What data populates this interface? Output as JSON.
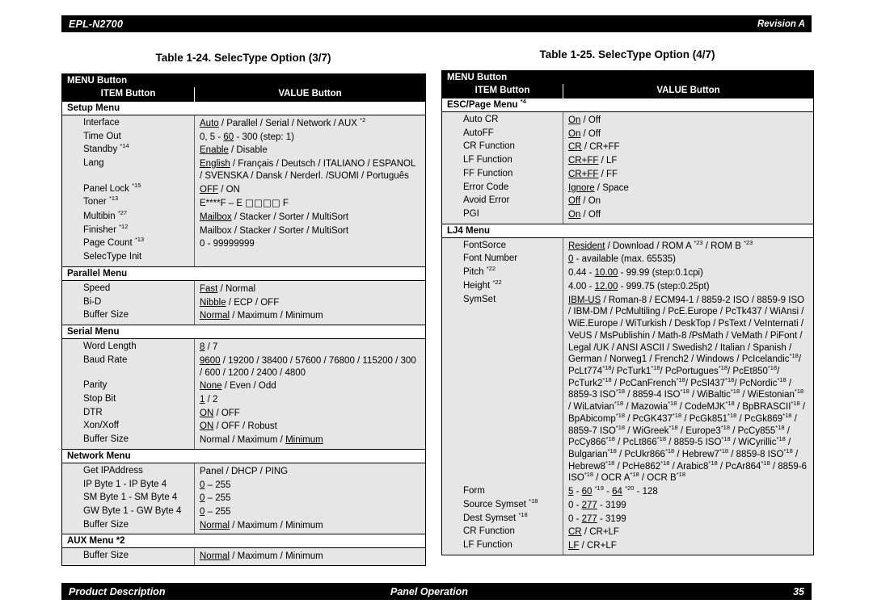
{
  "header": {
    "model": "EPL-N2700",
    "revision": "Revision A"
  },
  "footer": {
    "left": "Product Description",
    "center": "Panel Operation",
    "page": "35"
  },
  "tables": [
    {
      "caption": "Table 1-24.  SelecType Option (3/7)",
      "menu_header": "MENU Button",
      "col_item": "ITEM Button",
      "col_value": "VALUE Button",
      "sections": [
        {
          "title": "Setup Menu",
          "rows": [
            {
              "item": "Interface",
              "value": "<u>Auto</u> / Parallel / Serial / Network / AUX <sup>*2</sup>"
            },
            {
              "item": "Time Out",
              "value": "0, 5 - <u>60</u> - 300 (step: 1)"
            },
            {
              "item": "Standby <sup>*14</sup>",
              "value": "<u>Enable</u> / Disable"
            },
            {
              "item": "Lang",
              "value": "<u>English</u> / Français / Deutsch / ITALIANO / ESPANOL / SVENSKA / Dansk / Nerderl. /SUOMI / Português"
            },
            {
              "item": "Panel Lock <sup>*15</sup>",
              "value": "<u>OFF</u> / ON"
            },
            {
              "item": "Toner <sup>*13</sup>",
              "value": "E****F &ndash;  E <span class=\"sq\">□□□□</span> F"
            },
            {
              "item": "Multibin <sup>*27</sup>",
              "value": "<u>Mailbox</u> / Stacker / Sorter / MultiSort"
            },
            {
              "item": "Finisher <sup>*12</sup>",
              "value": "Mailbox / Stacker / Sorter / MultiSort"
            },
            {
              "item": "Page Count <sup>*13</sup>",
              "value": "0 - 99999999"
            },
            {
              "item": "SelecType Init",
              "value": ""
            }
          ]
        },
        {
          "title": "Parallel Menu",
          "rows": [
            {
              "item": "Speed",
              "value": "<u>Fast</u> / Normal"
            },
            {
              "item": "Bi-D",
              "value": "<u>Nibble</u> / ECP / OFF"
            },
            {
              "item": "Buffer Size",
              "value": "<u>Normal</u> / Maximum / Minimum"
            }
          ]
        },
        {
          "title": "Serial Menu",
          "rows": [
            {
              "item": "Word Length",
              "value": "<u>8</u> / 7"
            },
            {
              "item": "Baud Rate",
              "value": "<u>9600</u> / 19200 / 38400 / 57600 / 76800 / 115200 / 300 / 600 / 1200 / 2400 / 4800"
            },
            {
              "item": "Parity",
              "value": "<u>None</u> / Even / Odd"
            },
            {
              "item": "Stop Bit",
              "value": "<u>1</u> / 2"
            },
            {
              "item": "DTR",
              "value": "<u>ON</u> / OFF"
            },
            {
              "item": "Xon/Xoff",
              "value": "<u>ON</u> / OFF / Robust"
            },
            {
              "item": "Buffer Size",
              "value": "Normal / Maximum / <u>Minimum</u>"
            }
          ]
        },
        {
          "title": "Network Menu",
          "rows": [
            {
              "item": "Get IPAddress",
              "value": "Panel / DHCP / PING"
            },
            {
              "item": "IP Byte 1 - IP Byte 4",
              "value": "<u>0</u> &ndash; 255"
            },
            {
              "item": "SM Byte 1 - SM Byte 4",
              "value": "<u>0</u> &ndash; 255"
            },
            {
              "item": "GW Byte 1 - GW Byte 4",
              "value": "<u>0</u> &ndash; 255"
            },
            {
              "item": "Buffer Size",
              "value": "<u>Normal</u> / Maximum / Minimum"
            }
          ]
        },
        {
          "title": "AUX Menu *2",
          "rows": [
            {
              "item": "Buffer Size",
              "value": "<u>Normal</u> / Maximum / Minimum"
            }
          ]
        }
      ]
    },
    {
      "caption": "Table 1-25.  SelecType Option (4/7)",
      "menu_header": "MENU Button",
      "col_item": "ITEM Button",
      "col_value": "VALUE Button",
      "sections": [
        {
          "title": "ESC/Page Menu <sup>*4</sup>",
          "rows": [
            {
              "item": "Auto CR",
              "value": "<u>On</u> / Off"
            },
            {
              "item": "AutoFF",
              "value": "<u>On</u> / Off"
            },
            {
              "item": "CR Function",
              "value": "<u>CR</u> / CR+FF"
            },
            {
              "item": "LF Function",
              "value": "<u>CR+FF</u> / LF"
            },
            {
              "item": "FF Function",
              "value": "<u>CR+FF</u> / FF"
            },
            {
              "item": "Error Code",
              "value": "<u>Ignore</u> / Space"
            },
            {
              "item": "Avoid Error",
              "value": "<u>Off</u> / On"
            },
            {
              "item": "PGI",
              "value": "<u>On</u> / Off"
            }
          ]
        },
        {
          "title": "LJ4 Menu",
          "rows": [
            {
              "item": "FontSorce",
              "value": "<u>Resident</u> / Download / ROM A <sup>*23</sup> / ROM B <sup>*23</sup>"
            },
            {
              "item": "Font Number",
              "value": "<u>0</u> - available (max. 65535)"
            },
            {
              "item": "Pitch <sup>*22</sup>",
              "value": "0.44 - <u>10.00</u> - 99.99 (step:0.1cpi)"
            },
            {
              "item": "Height <sup>*22</sup>",
              "value": "4.00 - <u>12.00</u> - 999.75 (step:0.25pt)"
            },
            {
              "item": "SymSet",
              "value": "<u>IBM-US</u> / Roman-8 / ECM94-1 / 8859-2 ISO / 8859-9 ISO / IBM-DM / PcMultiling / PcE.Europe / PcTk437 / WiAnsi / WiE.Europe / WiTurkish / DeskTop / PsText / VeInternati / VeUS / MsPublishin / Math-8 /PsMath / VeMath / PiFont / Legal /UK / ANSI ASCII / Swedish2 / Italian / Spanish / German / Norweg1 / French2 / Windows / PcIcelandic<sup>*18</sup>/ PcLt774<sup>*18</sup>/ PcTurk1<sup>*18</sup>/ PcPortugues<sup>*18</sup>/ PcEt850<sup>*18</sup>/ PcTurk2<sup>*18</sup> / PcCanFrench<sup>*18</sup>/ PcSl437<sup>*18</sup>/ PcNordic<sup>*18</sup> / 8859-3 ISO<sup>*18</sup> / 8859-4 ISO<sup>*18</sup> / WiBaltic<sup>*18</sup> / WiEstonian<sup>*18</sup> / WiLatvian<sup>*18</sup> / Mazowia<sup>*18</sup> / CodeMJK<sup>*18</sup> / BpBRASCII<sup>*18</sup> / BpAbicomp<sup>*18</sup> / PcGK437<sup>*18</sup> / PcGk851<sup>*18</sup> / PcGk869<sup>*18</sup> / 8859-7 ISO<sup>*18</sup> / WiGreek<sup>*18</sup> / Europe3<sup>*18</sup> / PcCy855<sup>*18</sup> / PcCy866<sup>*18</sup> / PcLt866<sup>*18</sup> / 8859-5 ISO<sup>*18</sup> / WiCyrillic<sup>*18</sup> / Bulgarian<sup>*18</sup> / PcUkr866<sup>*18</sup> / Hebrew7<sup>*18</sup> / 8859-8 ISO<sup>*18</sup> / Hebrew8<sup>*18</sup> / PcHe862<sup>*18</sup> / Arabic8<sup>*18</sup> / PcAr864<sup>*18</sup> / 8859-6 ISO<sup>*18</sup> / OCR A<sup>*18</sup> / OCR B<sup>*18</sup>"
            },
            {
              "item": "Form",
              "value": "<u>5</u> - <u>60</u> <sup>*19</sup> - <u>64</u> <sup>*20</sup> - 128"
            },
            {
              "item": "Source Symset <sup>*18</sup>",
              "value": "0 - <u>277</u> - 3199"
            },
            {
              "item": "Dest Symset <sup>*18</sup>",
              "value": "0 - <u>277</u> - 3199"
            },
            {
              "item": "CR Function",
              "value": "<u>CR</u> / CR+LF"
            },
            {
              "item": "LF Function",
              "value": "<u>LF</u> / CR+LF"
            }
          ]
        }
      ]
    }
  ]
}
